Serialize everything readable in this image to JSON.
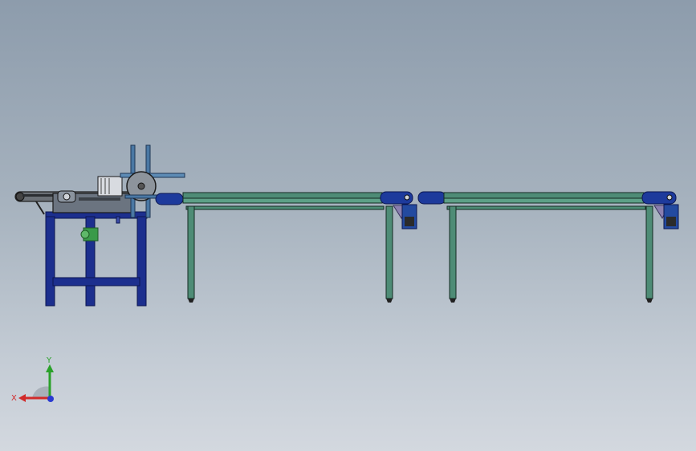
{
  "colors": {
    "background_top": "#8d9cac",
    "background_bottom": "#d3d8df",
    "frame_blue": "#1c2f8e",
    "rail_green": "#4e8c76",
    "motor_blue": "#1d3a9c",
    "x_axis": "#d12a2a",
    "y_axis": "#2aa12a",
    "z_axis": "#2a3ad1"
  },
  "triad": {
    "x_label": "X",
    "y_label": "Y"
  }
}
